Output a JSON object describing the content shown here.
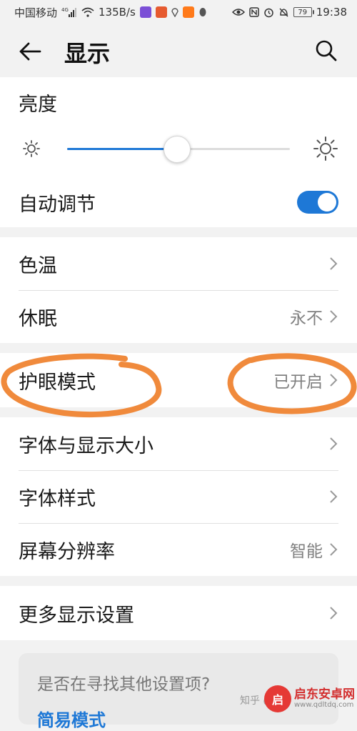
{
  "status_bar": {
    "carrier": "中国移动",
    "network_badge": "4G",
    "net_speed": "135B/s",
    "battery": "79",
    "time": "19:38"
  },
  "header": {
    "title": "显示",
    "back_icon": "arrow-left-icon",
    "search_icon": "search-icon"
  },
  "brightness": {
    "title": "亮度",
    "level": 0.49,
    "accent_color": "#1e78d6"
  },
  "auto_adjust": {
    "label": "自动调节",
    "enabled": true
  },
  "group1": [
    {
      "label": "色温",
      "value": ""
    },
    {
      "label": "休眠",
      "value": "永不"
    }
  ],
  "eye_mode": {
    "label": "护眼模式",
    "value": "已开启",
    "annotation_color": "#f08a3c"
  },
  "group2": [
    {
      "label": "字体与显示大小",
      "value": ""
    },
    {
      "label": "字体样式",
      "value": ""
    },
    {
      "label": "屏幕分辨率",
      "value": "智能"
    }
  ],
  "group3": [
    {
      "label": "更多显示设置",
      "value": ""
    }
  ],
  "suggestion": {
    "title": "是否在寻找其他设置项?",
    "link": "简易模式"
  },
  "watermark": {
    "zhihu": "知乎 @",
    "brand": "启东安卓网",
    "url": "www.qdltdq.com",
    "badge": "启"
  }
}
